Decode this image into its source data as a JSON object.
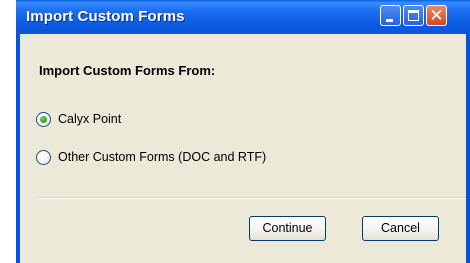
{
  "window": {
    "title": "Import Custom Forms",
    "controls": {
      "minimize": "minimize-icon",
      "maximize": "maximize-icon",
      "close": "close-icon",
      "close_glyph": "✕"
    }
  },
  "dialog": {
    "heading": "Import Custom Forms From:",
    "options": [
      {
        "label": "Calyx Point",
        "selected": true
      },
      {
        "label": "Other Custom Forms (DOC and RTF)",
        "selected": false
      }
    ],
    "buttons": {
      "continue_label": "Continue",
      "cancel_label": "Cancel"
    }
  },
  "colors": {
    "titlebar": "#0a55d8",
    "face": "#ece9d8",
    "radio_selected": "#21a121"
  }
}
